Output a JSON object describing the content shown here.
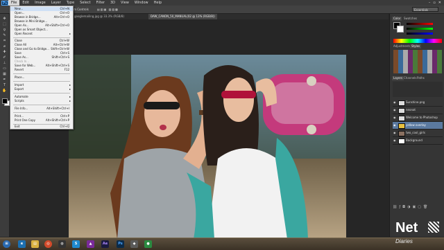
{
  "menubar": {
    "items": [
      "File",
      "Edit",
      "Image",
      "Layer",
      "Type",
      "Select",
      "Filter",
      "3D",
      "View",
      "Window",
      "Help"
    ],
    "ps_logo": "Ps"
  },
  "optionsbar": {
    "show_transform_controls": "Show Transform Controls",
    "workspace": "Essentials"
  },
  "doctabs": [
    {
      "label": "googlemailing.jpg @ 33.3% (RGB/8)"
    },
    {
      "label": "DAW_CANON_50_MANUAL(02 @ 13% (RGB/8))"
    }
  ],
  "file_menu": {
    "items": [
      {
        "label": "New...",
        "shortcut": "Ctrl+N"
      },
      {
        "label": "Open...",
        "shortcut": "Ctrl+O"
      },
      {
        "label": "Browse in Bridge...",
        "shortcut": "Alt+Ctrl+O"
      },
      {
        "label": "Browse in Mini Bridge...",
        "shortcut": ""
      },
      {
        "label": "Open As...",
        "shortcut": "Alt+Shift+Ctrl+O"
      },
      {
        "label": "Open as Smart Object...",
        "shortcut": ""
      },
      {
        "label": "Open Recent",
        "shortcut": ""
      },
      {
        "label": "Close",
        "shortcut": "Ctrl+W"
      },
      {
        "label": "Close All",
        "shortcut": "Alt+Ctrl+W"
      },
      {
        "label": "Close and Go to Bridge...",
        "shortcut": "Shift+Ctrl+W"
      },
      {
        "label": "Save",
        "shortcut": "Ctrl+S"
      },
      {
        "label": "Save As...",
        "shortcut": "Shift+Ctrl+S"
      },
      {
        "label": "Check In...",
        "shortcut": ""
      },
      {
        "label": "Save for Web...",
        "shortcut": "Alt+Shift+Ctrl+S"
      },
      {
        "label": "Revert",
        "shortcut": "F12"
      },
      {
        "label": "Place...",
        "shortcut": ""
      },
      {
        "label": "Import",
        "shortcut": ""
      },
      {
        "label": "Export",
        "shortcut": ""
      },
      {
        "label": "Automate",
        "shortcut": ""
      },
      {
        "label": "Scripts",
        "shortcut": ""
      },
      {
        "label": "File Info...",
        "shortcut": "Alt+Shift+Ctrl+I"
      },
      {
        "label": "Print...",
        "shortcut": "Ctrl+P"
      },
      {
        "label": "Print One Copy",
        "shortcut": "Alt+Shift+Ctrl+P"
      },
      {
        "label": "Exit",
        "shortcut": "Ctrl+Q"
      }
    ]
  },
  "panels": {
    "color_tabs": [
      "Color",
      "Swatches"
    ],
    "adjust_tabs": [
      "Adjustments",
      "Styles"
    ],
    "layers_tabs": [
      "Layers",
      "Channels",
      "Paths"
    ]
  },
  "layers": [
    {
      "name": "Sunshine.png"
    },
    {
      "name": "neonat"
    },
    {
      "name": "Welcome to Photoshop"
    },
    {
      "name": "yellow overlay",
      "selected": true
    },
    {
      "name": "two_cool_girls"
    },
    {
      "name": "Background"
    }
  ],
  "watermark": {
    "text": "Net",
    "subtext": "Diaries"
  },
  "colors": {
    "accent": "#5b7aa0",
    "menu_bg": "#f0f0f0",
    "ps_blue": "#4fa7ff"
  }
}
